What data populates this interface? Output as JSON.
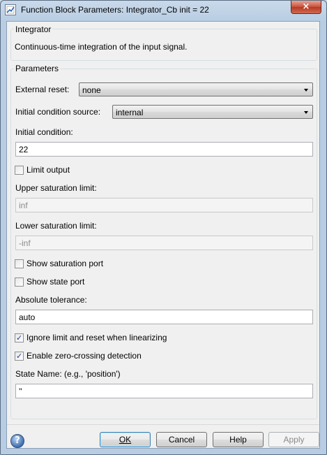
{
  "window": {
    "title": "Function Block Parameters: Integrator_Cb init = 22",
    "close_glyph": "×"
  },
  "block": {
    "group_label": "Integrator",
    "description": "Continuous-time integration of the input signal."
  },
  "parameters": {
    "group_label": "Parameters",
    "external_reset": {
      "label": "External reset:",
      "value": "none"
    },
    "ic_source": {
      "label": "Initial condition source:",
      "value": "internal"
    },
    "initial_condition": {
      "label": "Initial condition:",
      "value": "22"
    },
    "limit_output": {
      "label": "Limit output",
      "checked": false
    },
    "upper_limit": {
      "label": "Upper saturation limit:",
      "value": "inf"
    },
    "lower_limit": {
      "label": "Lower saturation limit:",
      "value": "-inf"
    },
    "show_sat_port": {
      "label": "Show saturation port",
      "checked": false
    },
    "show_state_port": {
      "label": "Show state port",
      "checked": false
    },
    "abs_tol": {
      "label": "Absolute tolerance:",
      "value": "auto"
    },
    "ignore_limit": {
      "label": "Ignore limit and reset when linearizing",
      "checked": true
    },
    "zero_crossing": {
      "label": "Enable zero-crossing detection",
      "checked": true
    },
    "state_name": {
      "label": "State Name: (e.g., 'position')",
      "value": "''"
    }
  },
  "buttons": {
    "ok": "OK",
    "cancel": "Cancel",
    "help": "Help",
    "apply": "Apply"
  },
  "help_icon_glyph": "?",
  "check_glyph": "✓"
}
